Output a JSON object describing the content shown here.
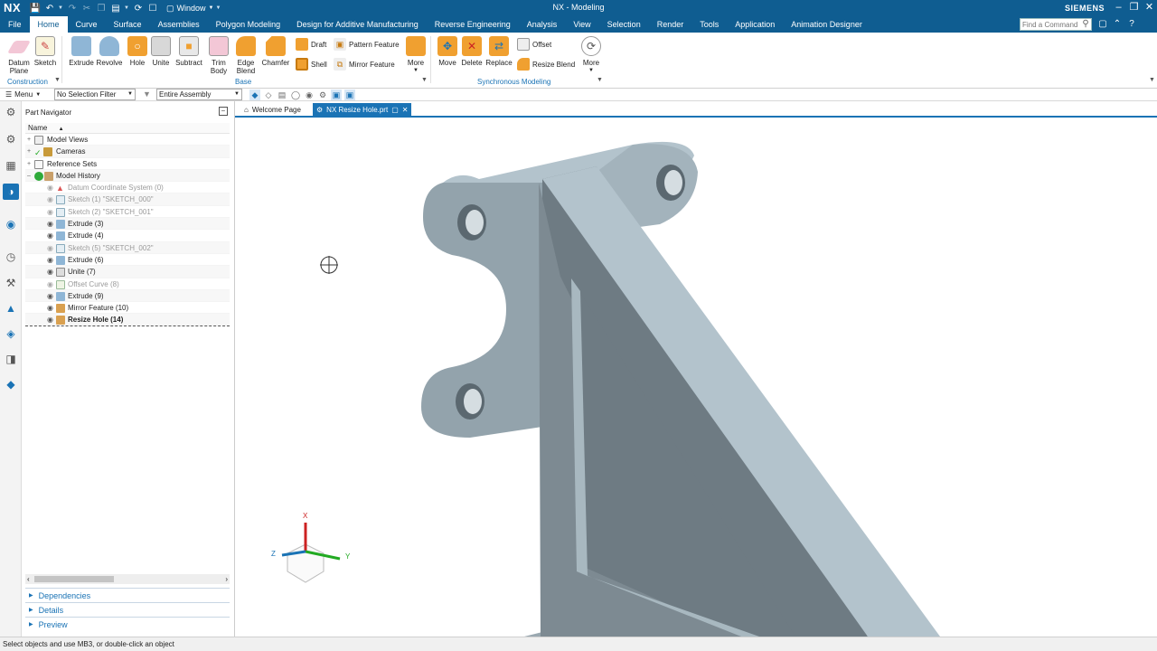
{
  "app": {
    "logo": "NX",
    "window_menu": "Window",
    "title": "NX - Modeling",
    "brand": "SIEMENS"
  },
  "tabs": [
    "File",
    "Home",
    "Curve",
    "Surface",
    "Assemblies",
    "Polygon Modeling",
    "Design for Additive Manufacturing",
    "Reverse Engineering",
    "Analysis",
    "View",
    "Selection",
    "Render",
    "Tools",
    "Application",
    "Animation Designer"
  ],
  "find_command": {
    "placeholder": "Find a Command"
  },
  "ribbon": {
    "construction": {
      "datum_plane": "Datum Plane",
      "sketch": "Sketch",
      "group": "Construction"
    },
    "base": {
      "extrude": "Extrude",
      "revolve": "Revolve",
      "hole": "Hole",
      "unite": "Unite",
      "subtract": "Subtract",
      "trim_body": "Trim Body",
      "edge_blend": "Edge Blend",
      "chamfer": "Chamfer",
      "draft": "Draft",
      "shell": "Shell",
      "pattern_feature": "Pattern Feature",
      "mirror_feature": "Mirror Feature",
      "more": "More",
      "group": "Base"
    },
    "sync": {
      "move": "Move",
      "delete": "Delete",
      "replace": "Replace",
      "offset": "Offset",
      "resize_blend": "Resize Blend",
      "more": "More",
      "group": "Synchronous Modeling"
    }
  },
  "selection_bar": {
    "menu": "Menu",
    "filter": "No Selection Filter",
    "scope": "Entire Assembly"
  },
  "navigator": {
    "title": "Part Navigator",
    "column": "Name",
    "rows": [
      {
        "label": "Model Views"
      },
      {
        "label": "Cameras"
      },
      {
        "label": "Reference Sets"
      },
      {
        "label": "Model History"
      },
      {
        "label": "Datum Coordinate System (0)"
      },
      {
        "label": "Sketch (1) \"SKETCH_000\""
      },
      {
        "label": "Sketch (2) \"SKETCH_001\""
      },
      {
        "label": "Extrude (3)"
      },
      {
        "label": "Extrude (4)"
      },
      {
        "label": "Sketch (5) \"SKETCH_002\""
      },
      {
        "label": "Extrude (6)"
      },
      {
        "label": "Unite (7)"
      },
      {
        "label": "Offset Curve (8)"
      },
      {
        "label": "Extrude (9)"
      },
      {
        "label": "Mirror Feature (10)"
      },
      {
        "label": "Resize Hole (14)"
      }
    ],
    "panels": [
      "Dependencies",
      "Details",
      "Preview"
    ]
  },
  "doc_tabs": {
    "welcome": "Welcome Page",
    "active": "NX Resize Hole.prt"
  },
  "triad": {
    "x": "X",
    "y": "Y",
    "z": "Z"
  },
  "status": "Select objects and use MB3, or double-click an object",
  "colors": {
    "titlebar": "#0f5d91",
    "accent": "#1a73b5",
    "part_light": "#b3c3cc",
    "part_mid": "#93a3ac",
    "part_dark": "#6e7b83"
  }
}
